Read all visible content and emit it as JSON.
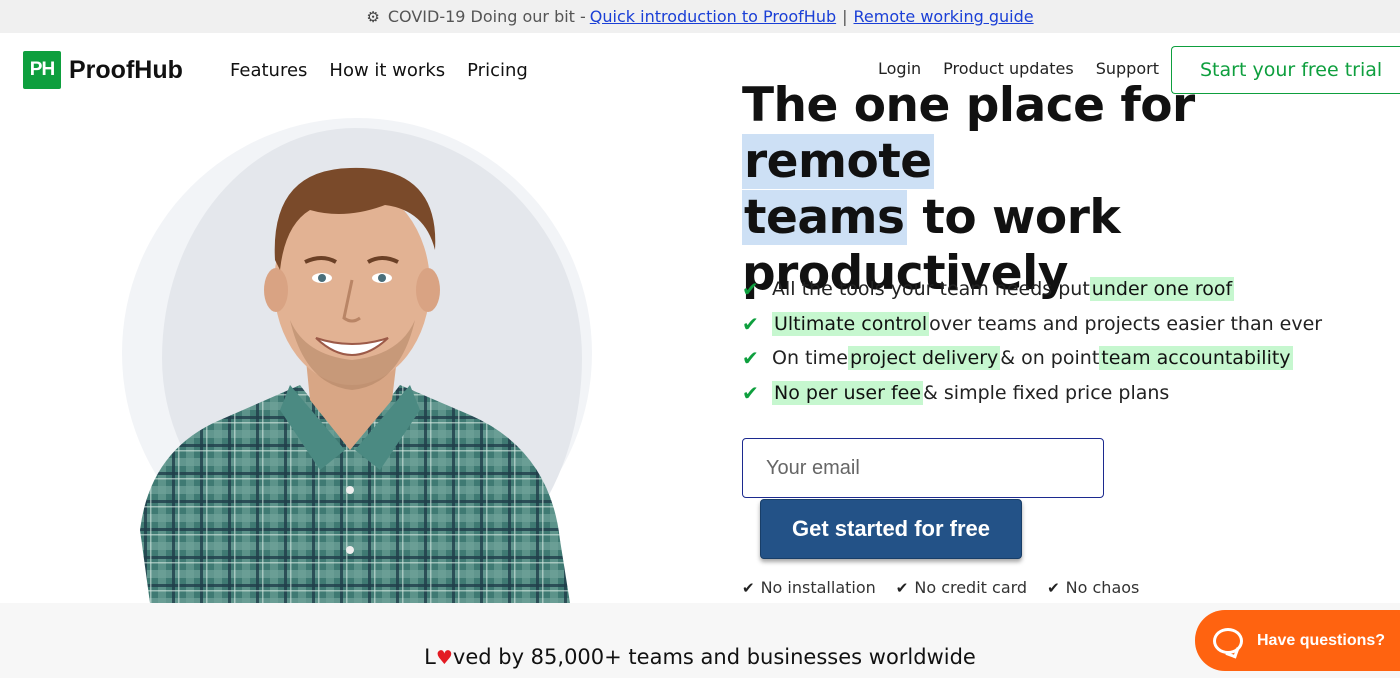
{
  "banner": {
    "icon": "gear-icon",
    "text": "COVID-19 Doing our bit -",
    "link1": "Quick introduction to ProofHub",
    "separator": "|",
    "link2": "Remote working guide"
  },
  "logo": {
    "badge": "PH",
    "name": "ProofHub",
    "brand_color": "#0e9f3e"
  },
  "nav_left": [
    "Features",
    "How it works",
    "Pricing"
  ],
  "nav_right": [
    "Login",
    "Product updates",
    "Support"
  ],
  "trial_button": "Start your free trial",
  "headline": {
    "part1": "The one place for ",
    "highlight1": "remote",
    "part2": " ",
    "highlight2": "teams",
    "part3": " to work productively"
  },
  "features": [
    {
      "pre": "All the tools your team needs put ",
      "hl": "under one roof",
      "post": ""
    },
    {
      "pre": "",
      "hl": "Ultimate control",
      "post": " over teams and projects easier than ever"
    },
    {
      "pre": "On time ",
      "hl": "project delivery",
      "mid": " & on point ",
      "hl2": "team accountability",
      "post": ""
    },
    {
      "pre": "",
      "hl": "No per user fee",
      "post": " & simple fixed price plans"
    }
  ],
  "form": {
    "email_placeholder": "Your email",
    "cta": "Get started for free",
    "cta_color": "#235287"
  },
  "assurances": [
    "No installation",
    "No credit card",
    "No chaos"
  ],
  "loved": {
    "prefix": "L",
    "suffix": "ved by 85,000+ teams and businesses worldwide"
  },
  "chat": {
    "label": "Have questions?",
    "color": "#ff6310"
  }
}
